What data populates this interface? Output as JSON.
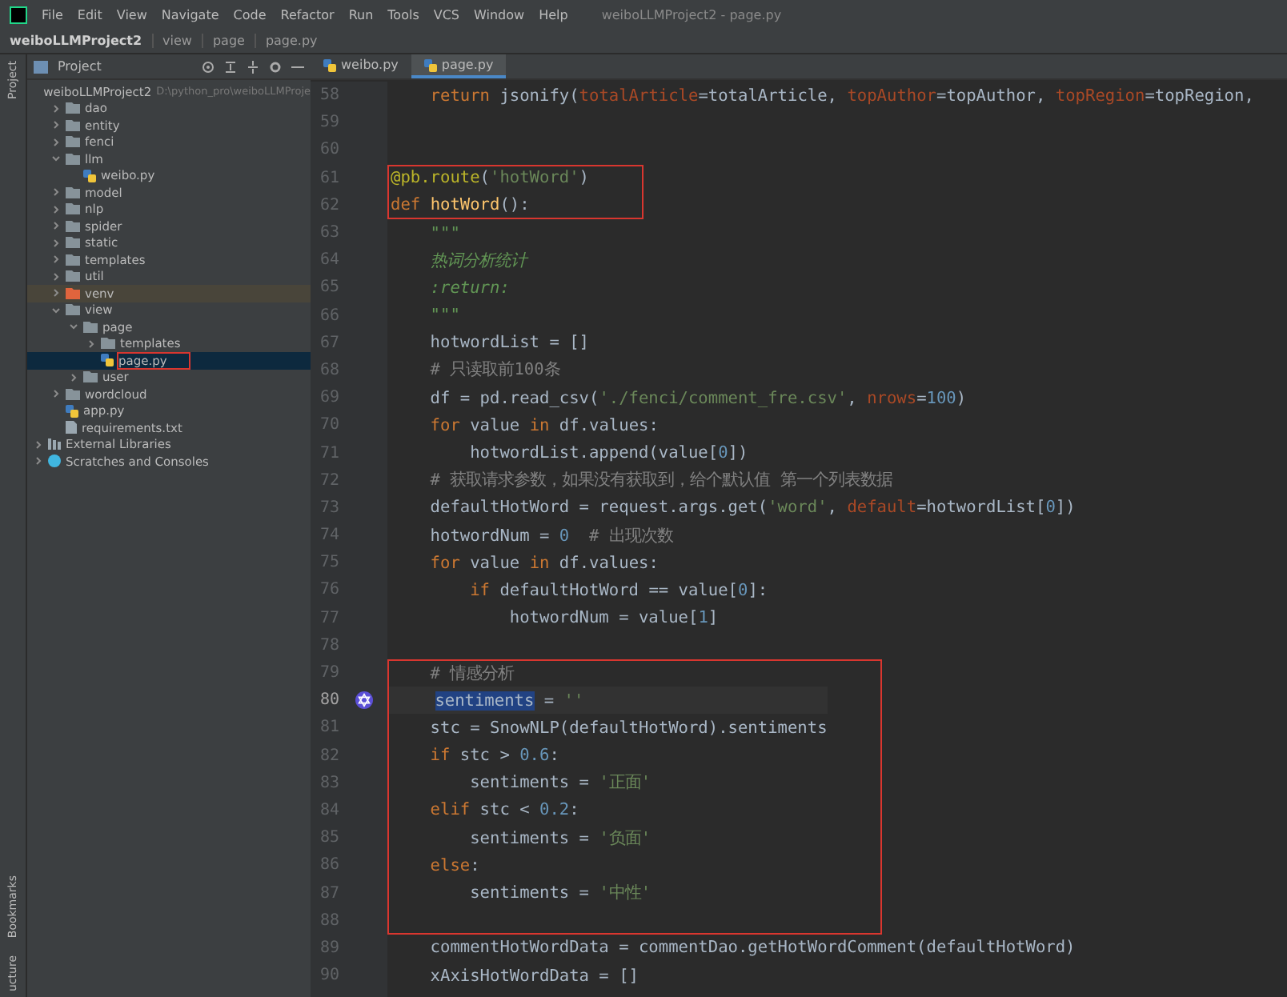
{
  "menu": [
    "File",
    "Edit",
    "View",
    "Navigate",
    "Code",
    "Refactor",
    "Run",
    "Tools",
    "VCS",
    "Window",
    "Help"
  ],
  "window_title": "weiboLLMProject2 - page.py",
  "breadcrumb": [
    "weiboLLMProject2",
    "view",
    "page",
    "page.py"
  ],
  "side_stripe": {
    "top": [
      "Project"
    ],
    "bottom": [
      "Bookmarks",
      "ucture"
    ]
  },
  "project_panel": {
    "title": "Project",
    "tree": [
      {
        "label": "weiboLLMProject2",
        "kind": "folder",
        "expanded": true,
        "hint": "D:\\python_pro\\weiboLLMProje",
        "children": [
          {
            "label": "dao",
            "kind": "folder",
            "expanded": false
          },
          {
            "label": "entity",
            "kind": "folder",
            "expanded": false
          },
          {
            "label": "fenci",
            "kind": "folder",
            "expanded": false
          },
          {
            "label": "llm",
            "kind": "folder",
            "expanded": true,
            "children": [
              {
                "label": "weibo.py",
                "kind": "python"
              }
            ]
          },
          {
            "label": "model",
            "kind": "folder",
            "expanded": false
          },
          {
            "label": "nlp",
            "kind": "folder",
            "expanded": false
          },
          {
            "label": "spider",
            "kind": "folder",
            "expanded": false
          },
          {
            "label": "static",
            "kind": "folder",
            "expanded": false
          },
          {
            "label": "templates",
            "kind": "folder",
            "expanded": false
          },
          {
            "label": "util",
            "kind": "folder",
            "expanded": false
          },
          {
            "label": "venv",
            "kind": "excluded",
            "expanded": false,
            "highlighted": true
          },
          {
            "label": "view",
            "kind": "folder",
            "expanded": true,
            "children": [
              {
                "label": "page",
                "kind": "folder",
                "expanded": true,
                "children": [
                  {
                    "label": "templates",
                    "kind": "folder",
                    "expanded": false
                  },
                  {
                    "label": "page.py",
                    "kind": "python",
                    "selected": true,
                    "annotated": true
                  }
                ]
              },
              {
                "label": "user",
                "kind": "folder",
                "expanded": false
              }
            ]
          },
          {
            "label": "wordcloud",
            "kind": "folder",
            "expanded": false
          },
          {
            "label": "app.py",
            "kind": "python"
          },
          {
            "label": "requirements.txt",
            "kind": "text"
          }
        ]
      },
      {
        "label": "External Libraries",
        "kind": "library",
        "expanded": false
      },
      {
        "label": "Scratches and Consoles",
        "kind": "scratch",
        "expanded": false
      }
    ]
  },
  "tabs": [
    {
      "label": "weibo.py",
      "selected": false
    },
    {
      "label": "page.py",
      "selected": true
    }
  ],
  "code": {
    "blocks": [
      {
        "kind": "plain",
        "lines": [
          {
            "number": "58",
            "tokens": [
              {
                "kind": "kw",
                "text": "    return"
              },
              {
                "kind": "plain",
                "text": " jsonify("
              },
              {
                "kind": "param",
                "text": "totalArticle"
              },
              {
                "kind": "plain",
                "text": "=totalArticle, "
              },
              {
                "kind": "param",
                "text": "topAuthor"
              },
              {
                "kind": "plain",
                "text": "=topAuthor, "
              },
              {
                "kind": "param",
                "text": "topRegion"
              },
              {
                "kind": "plain",
                "text": "=topRegion,"
              }
            ]
          },
          {
            "number": "59"
          },
          {
            "number": "60"
          }
        ]
      },
      {
        "kind": "annotated",
        "lines": [
          {
            "number": "61",
            "tokens": [
              {
                "kind": "deco",
                "text": "@pb.route"
              },
              {
                "kind": "plain",
                "text": "("
              },
              {
                "kind": "str",
                "text": "'hotWord'"
              },
              {
                "kind": "plain",
                "text": ")"
              }
            ]
          },
          {
            "number": "62",
            "tokens": [
              {
                "kind": "kw",
                "text": "def "
              },
              {
                "kind": "fn",
                "text": "hotWord"
              },
              {
                "kind": "plain",
                "text": "():"
              }
            ]
          }
        ]
      },
      {
        "kind": "plain",
        "lines": [
          {
            "number": "63",
            "tokens": [
              {
                "kind": "doc",
                "text": "    \"\"\""
              }
            ]
          },
          {
            "number": "64",
            "tokens": [
              {
                "kind": "doc",
                "text": "    热词分析统计"
              }
            ]
          },
          {
            "number": "65",
            "tokens": [
              {
                "kind": "doc",
                "text": "    :return:"
              }
            ]
          },
          {
            "number": "66",
            "tokens": [
              {
                "kind": "doc",
                "text": "    \"\"\""
              }
            ]
          },
          {
            "number": "67",
            "tokens": [
              {
                "kind": "plain",
                "text": "    hotwordList = []"
              }
            ]
          },
          {
            "number": "68",
            "tokens": [
              {
                "kind": "cmt",
                "text": "    # 只读取前100条"
              }
            ]
          },
          {
            "number": "69",
            "tokens": [
              {
                "kind": "plain",
                "text": "    df = pd.read_csv("
              },
              {
                "kind": "str",
                "text": "'./fenci/comment_fre.csv'"
              },
              {
                "kind": "plain",
                "text": ", "
              },
              {
                "kind": "param",
                "text": "nrows"
              },
              {
                "kind": "plain",
                "text": "="
              },
              {
                "kind": "num",
                "text": "100"
              },
              {
                "kind": "plain",
                "text": ")"
              }
            ]
          },
          {
            "number": "70",
            "tokens": [
              {
                "kind": "kw",
                "text": "    for"
              },
              {
                "kind": "plain",
                "text": " value "
              },
              {
                "kind": "kw",
                "text": "in"
              },
              {
                "kind": "plain",
                "text": " df.values:"
              }
            ]
          },
          {
            "number": "71",
            "tokens": [
              {
                "kind": "plain",
                "text": "        hotwordList.append(value["
              },
              {
                "kind": "num",
                "text": "0"
              },
              {
                "kind": "plain",
                "text": "])"
              }
            ]
          },
          {
            "number": "72",
            "tokens": [
              {
                "kind": "cmt",
                "text": "    # 获取请求参数，如果没有获取到，给个默认值 第一个列表数据"
              }
            ]
          },
          {
            "number": "73",
            "tokens": [
              {
                "kind": "plain",
                "text": "    defaultHotWord = request.args.get("
              },
              {
                "kind": "str",
                "text": "'word'"
              },
              {
                "kind": "plain",
                "text": ", "
              },
              {
                "kind": "param",
                "text": "default"
              },
              {
                "kind": "plain",
                "text": "=hotwordList["
              },
              {
                "kind": "num",
                "text": "0"
              },
              {
                "kind": "plain",
                "text": "])"
              }
            ]
          },
          {
            "number": "74",
            "tokens": [
              {
                "kind": "plain",
                "text": "    hotwordNum = "
              },
              {
                "kind": "num",
                "text": "0"
              },
              {
                "kind": "cmt",
                "text": "  # 出现次数"
              }
            ]
          },
          {
            "number": "75",
            "tokens": [
              {
                "kind": "kw",
                "text": "    for"
              },
              {
                "kind": "plain",
                "text": " value "
              },
              {
                "kind": "kw",
                "text": "in"
              },
              {
                "kind": "plain",
                "text": " df.values:"
              }
            ]
          },
          {
            "number": "76",
            "tokens": [
              {
                "kind": "kw",
                "text": "        if"
              },
              {
                "kind": "plain",
                "text": " defaultHotWord == value["
              },
              {
                "kind": "num",
                "text": "0"
              },
              {
                "kind": "plain",
                "text": "]:"
              }
            ]
          },
          {
            "number": "77",
            "tokens": [
              {
                "kind": "plain",
                "text": "            hotwordNum = value["
              },
              {
                "kind": "num",
                "text": "1"
              },
              {
                "kind": "plain",
                "text": "]"
              }
            ]
          },
          {
            "number": "78"
          }
        ]
      },
      {
        "kind": "annotated",
        "lines": [
          {
            "number": "79",
            "tokens": [
              {
                "kind": "cmt",
                "text": "    # 情感分析"
              }
            ]
          },
          {
            "number": "80",
            "current": true,
            "tokens": [
              {
                "kind": "sel",
                "text": "sentiments"
              },
              {
                "kind": "plain",
                "text": " = "
              },
              {
                "kind": "str",
                "text": "''"
              }
            ]
          },
          {
            "number": "81",
            "tokens": [
              {
                "kind": "plain",
                "text": "    stc = SnowNLP(defaultHotWord).sentiments"
              }
            ]
          },
          {
            "number": "82",
            "tokens": [
              {
                "kind": "kw",
                "text": "    if"
              },
              {
                "kind": "plain",
                "text": " stc > "
              },
              {
                "kind": "num",
                "text": "0.6"
              },
              {
                "kind": "plain",
                "text": ":"
              }
            ]
          },
          {
            "number": "83",
            "tokens": [
              {
                "kind": "plain",
                "text": "        sentiments = "
              },
              {
                "kind": "str",
                "text": "'正面'"
              }
            ]
          },
          {
            "number": "84",
            "tokens": [
              {
                "kind": "kw",
                "text": "    elif"
              },
              {
                "kind": "plain",
                "text": " stc < "
              },
              {
                "kind": "num",
                "text": "0.2"
              },
              {
                "kind": "plain",
                "text": ":"
              }
            ]
          },
          {
            "number": "85",
            "tokens": [
              {
                "kind": "plain",
                "text": "        sentiments = "
              },
              {
                "kind": "str",
                "text": "'负面'"
              }
            ]
          },
          {
            "number": "86",
            "tokens": [
              {
                "kind": "kw",
                "text": "    else"
              },
              {
                "kind": "plain",
                "text": ":"
              }
            ]
          },
          {
            "number": "87",
            "tokens": [
              {
                "kind": "plain",
                "text": "        sentiments = "
              },
              {
                "kind": "str",
                "text": "'中性'"
              }
            ]
          },
          {
            "number": "88"
          }
        ]
      },
      {
        "kind": "plain",
        "lines": [
          {
            "number": "89",
            "tokens": [
              {
                "kind": "plain",
                "text": "    commentHotWordData = commentDao.getHotWordComment(defaultHotWord)"
              }
            ]
          },
          {
            "number": "90",
            "tokens": [
              {
                "kind": "plain",
                "text": "    xAxisHotWordData = []"
              }
            ]
          }
        ]
      }
    ]
  }
}
